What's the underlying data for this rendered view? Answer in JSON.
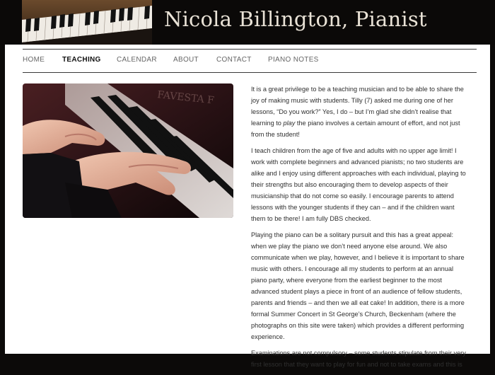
{
  "site": {
    "title": "Nicola Billington, Pianist"
  },
  "nav": {
    "items": [
      {
        "label": "HOME",
        "active": false
      },
      {
        "label": "TEACHING",
        "active": true
      },
      {
        "label": "CALENDAR",
        "active": false
      },
      {
        "label": "ABOUT",
        "active": false
      },
      {
        "label": "CONTACT",
        "active": false
      },
      {
        "label": "PIANO NOTES",
        "active": false
      }
    ]
  },
  "hero": {
    "watermark": "FAVESTA F"
  },
  "content": {
    "p1": {
      "before": "It is a great privilege to be a teaching musician and to be able to share the joy of making music with students. Tilly (7) asked me during one of her lessons, “Do you work?” Yes, I do – but I’m glad she didn’t realise that learning to ",
      "em": "play",
      "after": " the piano involves a certain amount of effort, and not just from the student!"
    },
    "p2": "I teach children from the age of five and adults with no upper age limit! I work with complete beginners and advanced pianists; no two students are alike and I enjoy using different approaches with each individual, playing to their strengths but also encouraging them to develop aspects of their musicianship that do not come so easily. I encourage parents to attend lessons with the younger students if they can – and if the children want them to be there! I am fully DBS checked.",
    "p3": "Playing the piano can be a solitary pursuit and this has a great appeal: when we play the piano we don’t need anyone else around. We also communicate when we play, however, and I believe it is important to share music with others. I encourage all my students to perform at an annual piano party, where everyone from the earliest beginner to the most advanced student plays a piece in front of an audience of fellow students, parents and friends – and then we all eat cake! In addition, there is a more formal Summer Concert in St George’s Church, Beckenham (where the photographs on this site were taken) which provides a different performing experience.",
    "p4": "Examinations are not compulsory – some students stipulate from their very first lesson that they want to play for fun and not to take exams and this is"
  }
}
